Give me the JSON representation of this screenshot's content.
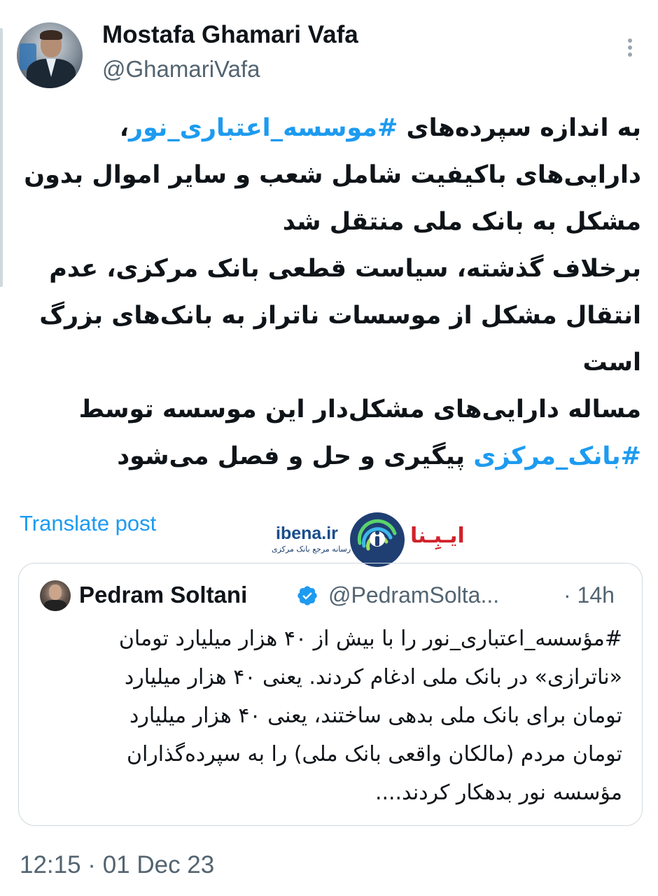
{
  "author": {
    "name": "Mostafa Ghamari Vafa",
    "handle": "@GhamariVafa"
  },
  "tweet": {
    "lines": [
      [
        {
          "text": "به اندازه سپرده‌های ",
          "hashtag": false
        },
        {
          "text": "#موسسه_اعتباری_نور",
          "hashtag": true
        },
        {
          "text": "،",
          "hashtag": false
        }
      ],
      [
        {
          "text": "دارایی‌های باکیفیت شامل شعب و سایر اموال بدون",
          "hashtag": false
        }
      ],
      [
        {
          "text": "مشکل به بانک ملی منتقل شد",
          "hashtag": false
        }
      ],
      [
        {
          "text": "برخلاف گذشته، سیاست قطعی بانک مرکزی، عدم",
          "hashtag": false
        }
      ],
      [
        {
          "text": "انتقال مشکل از موسسات ناتراز به بانک‌های بزرگ",
          "hashtag": false
        }
      ],
      [
        {
          "text": "است",
          "hashtag": false
        }
      ],
      [
        {
          "text": "مساله دارایی‌های مشکل‌دار این موسسه توسط",
          "hashtag": false
        }
      ],
      [
        {
          "text": "#بانک_مرکزی",
          "hashtag": true
        },
        {
          "text": " پیگیری و حل و فصل می‌شود",
          "hashtag": false
        }
      ]
    ],
    "translate_label": "Translate post",
    "timestamp": "12:15 · 01 Dec 23"
  },
  "watermark": {
    "domain": "ibena.ir",
    "tagline": "رسانه مرجع بانک مرکزی",
    "brand": "ایـبِـنا"
  },
  "quoted": {
    "name": "Pedram Soltani",
    "handle": "@PedramSolta...",
    "time": "· 14h",
    "verified_color": "#1d9bf0",
    "lines": [
      "#مؤسسه_اعتباری_نور را با بیش از ۴۰ هزار میلیارد تومان",
      "«ناترازی» در بانک ملی ادغام کردند. یعنی ۴۰ هزار میلیارد",
      "تومان برای بانک ملی بدهی ساختند، یعنی ۴۰ هزار میلیارد",
      "تومان مردم (مالکان واقعی بانک ملی) را به سپرده‌گذاران",
      "مؤسسه نور بدهکار کردند...."
    ]
  },
  "colors": {
    "link": "#1d9bf0",
    "text": "#0f1419",
    "secondary": "#536471"
  },
  "icons": {
    "more": "more-vertical-icon",
    "verified": "verified-badge-icon"
  }
}
